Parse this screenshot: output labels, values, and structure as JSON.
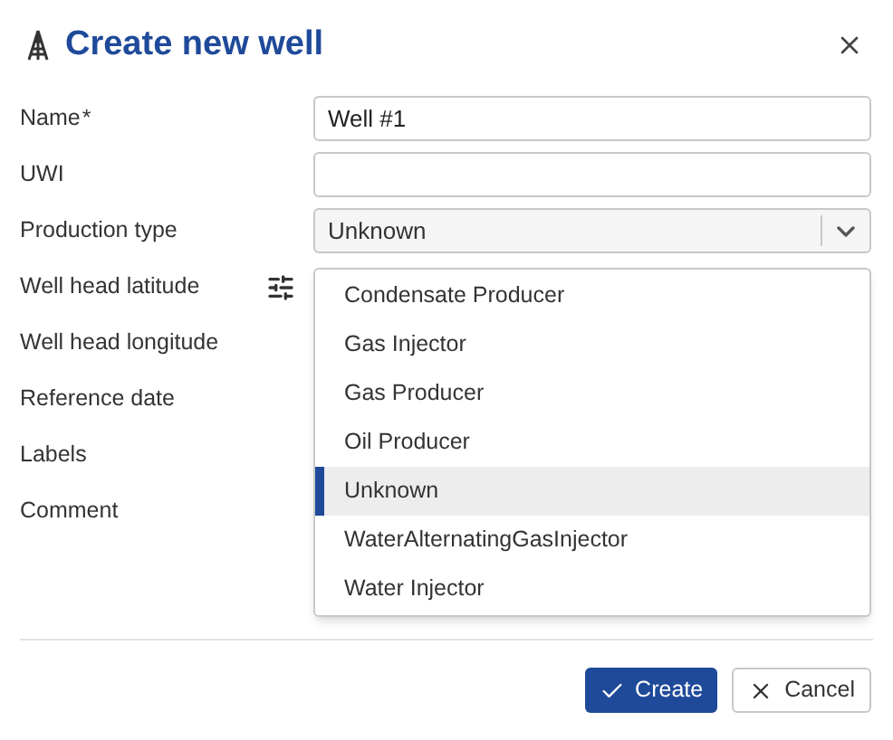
{
  "dialog": {
    "title": "Create new well"
  },
  "fields": [
    {
      "label": "Name",
      "required_mark": "*",
      "kind": "text",
      "value": "Well #1"
    },
    {
      "label": "UWI",
      "kind": "text"
    },
    {
      "label": "Production type",
      "kind": "select",
      "value": "Unknown"
    },
    {
      "label": "Well head latitude",
      "kind": "coordinate"
    },
    {
      "label": "Well head longitude",
      "kind": "covered"
    },
    {
      "label": "Reference date",
      "kind": "covered"
    },
    {
      "label": "Labels",
      "kind": "covered"
    },
    {
      "label": "Comment",
      "kind": "covered"
    }
  ],
  "dropdown": {
    "options": [
      {
        "label": "Condensate Producer",
        "selected": false
      },
      {
        "label": "Gas Injector",
        "selected": false
      },
      {
        "label": "Gas Producer",
        "selected": false
      },
      {
        "label": "Oil Producer",
        "selected": false
      },
      {
        "label": "Unknown",
        "selected": true
      },
      {
        "label": "WaterAlternatingGasInjector",
        "selected": false
      },
      {
        "label": "Water Injector",
        "selected": false
      }
    ]
  },
  "buttons": [
    {
      "label": "Create",
      "kind": "primary"
    },
    {
      "label": "Cancel",
      "kind": "secondary"
    }
  ]
}
